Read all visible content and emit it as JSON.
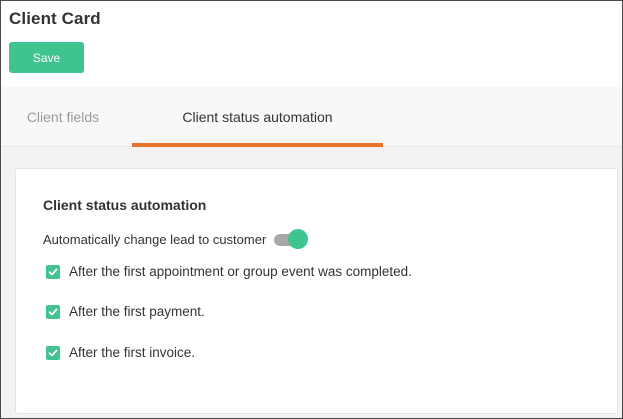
{
  "header": {
    "title": "Client Card",
    "save_label": "Save"
  },
  "tabs": [
    {
      "label": "Client fields",
      "active": false
    },
    {
      "label": "Client status automation",
      "active": true
    }
  ],
  "section": {
    "title": "Client status automation",
    "toggle": {
      "label": "Automatically change lead to customer",
      "on": true
    },
    "options": [
      {
        "label": "After the first appointment or group event was completed.",
        "checked": true
      },
      {
        "label": "After the first payment.",
        "checked": true
      },
      {
        "label": "After the first invoice.",
        "checked": true
      }
    ]
  },
  "colors": {
    "accent_green": "#3fc38f",
    "tab_underline": "#e8732e",
    "toggle_track": "#a8a8a8"
  },
  "icons": {
    "checkbox": "checkmark-icon"
  }
}
